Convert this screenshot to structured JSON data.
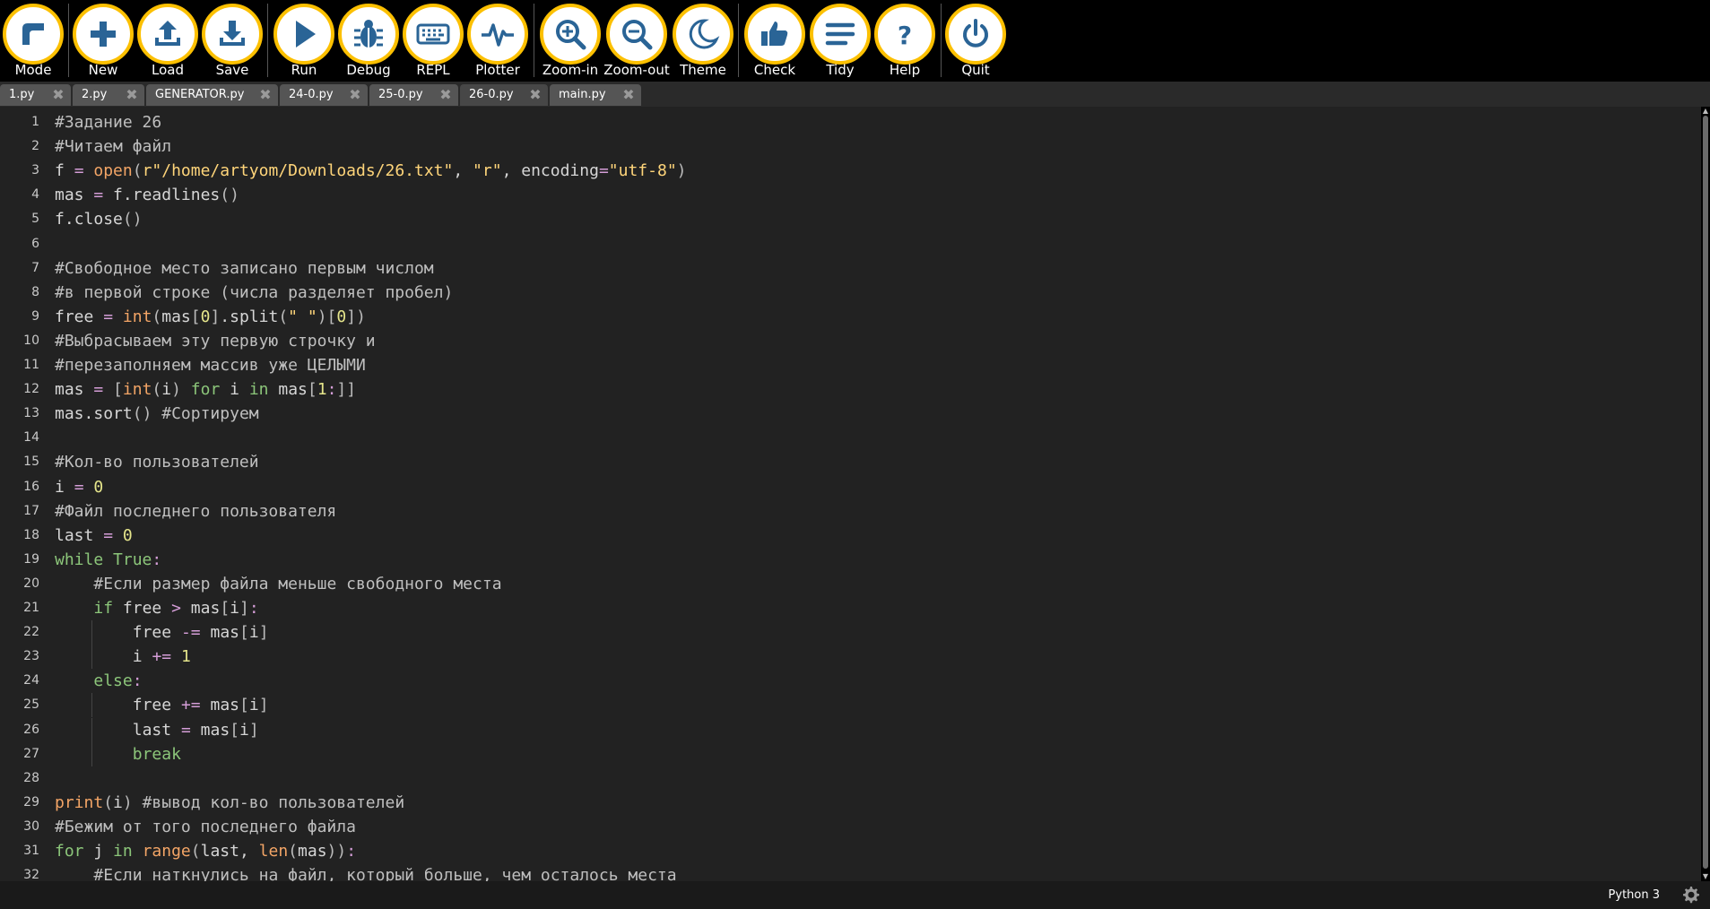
{
  "toolbar": {
    "buttons": [
      {
        "label": "Mode",
        "icon": "mode-icon"
      },
      {
        "label": "New",
        "icon": "plus-icon"
      },
      {
        "label": "Load",
        "icon": "upload-icon"
      },
      {
        "label": "Save",
        "icon": "download-icon"
      },
      {
        "label": "Run",
        "icon": "play-icon"
      },
      {
        "label": "Debug",
        "icon": "bug-icon"
      },
      {
        "label": "REPL",
        "icon": "keyboard-icon"
      },
      {
        "label": "Plotter",
        "icon": "pulse-icon"
      },
      {
        "label": "Zoom-in",
        "icon": "zoom-in-icon"
      },
      {
        "label": "Zoom-out",
        "icon": "zoom-out-icon"
      },
      {
        "label": "Theme",
        "icon": "moon-icon"
      },
      {
        "label": "Check",
        "icon": "thumbs-up-icon"
      },
      {
        "label": "Tidy",
        "icon": "lines-icon"
      },
      {
        "label": "Help",
        "icon": "question-icon"
      },
      {
        "label": "Quit",
        "icon": "power-icon"
      }
    ],
    "accent": "#fcc001",
    "icon_color": "#2a6496"
  },
  "tabs": [
    {
      "label": "1.py"
    },
    {
      "label": "2.py"
    },
    {
      "label": "GENERATOR.py"
    },
    {
      "label": "24-0.py"
    },
    {
      "label": "25-0.py"
    },
    {
      "label": "26-0.py",
      "active": true
    },
    {
      "label": "main.py"
    }
  ],
  "editor": {
    "line_numbers": [
      "1",
      "2",
      "3",
      "4",
      "5",
      "6",
      "7",
      "8",
      "9",
      "10",
      "11",
      "12",
      "13",
      "14",
      "15",
      "16",
      "17",
      "18",
      "19",
      "20",
      "21",
      "22",
      "23",
      "24",
      "25",
      "26",
      "27",
      "28",
      "29",
      "30",
      "31",
      "32"
    ],
    "lines": [
      "#Задание 26",
      "#Читаем файл",
      "f = open(r\"/home/artyom/Downloads/26.txt\", \"r\", encoding=\"utf-8\")",
      "mas = f.readlines()",
      "f.close()",
      "",
      "#Свободное место записано первым числом",
      "#в первой строке (числа разделяет пробел)",
      "free = int(mas[0].split(\" \")[0])",
      "#Выбрасываем эту первую строчку и",
      "#перезаполняем массив уже ЦЕЛЫМИ",
      "mas = [int(i) for i in mas[1:]]",
      "mas.sort() #Сортируем",
      "",
      "#Кол-во пользователей",
      "i = 0",
      "#Файл последнего пользователя",
      "last = 0",
      "while True:",
      "    #Если размер файла меньше свободного места",
      "    if free > mas[i]:",
      "        free -= mas[i]",
      "        i += 1",
      "    else:",
      "        free += mas[i]",
      "        last = mas[i]",
      "        break",
      "",
      "print(i) #вывод кол-во пользователей",
      "#Бежим от того последнего файла",
      "for j in range(last, len(mas)):",
      "    #Если наткнулись на файл, который больше, чем осталось места"
    ]
  },
  "status": {
    "mode": "Python 3"
  }
}
